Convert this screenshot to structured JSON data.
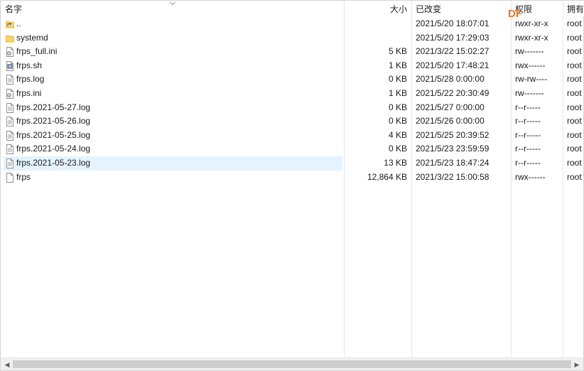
{
  "columns": {
    "name": "名字",
    "size": "大小",
    "modified": "已改变",
    "permissions": "权限",
    "owner": "拥有"
  },
  "watermark": "DF",
  "files": [
    {
      "name": "..",
      "size": "",
      "modified": "2021/5/20 18:07:01",
      "permissions": "rwxr-xr-x",
      "owner": "root",
      "icon": "parent-folder-icon"
    },
    {
      "name": "systemd",
      "size": "",
      "modified": "2021/5/20 17:29:03",
      "permissions": "rwxr-xr-x",
      "owner": "root",
      "icon": "folder-icon"
    },
    {
      "name": "frps_full.ini",
      "size": "5 KB",
      "modified": "2021/3/22 15:02:27",
      "permissions": "rw-------",
      "owner": "root",
      "icon": "settings-file-icon"
    },
    {
      "name": "frps.sh",
      "size": "1 KB",
      "modified": "2021/5/20 17:48:21",
      "permissions": "rwx------",
      "owner": "root",
      "icon": "script-file-icon"
    },
    {
      "name": "frps.log",
      "size": "0 KB",
      "modified": "2021/5/28 0:00:00",
      "permissions": "rw-rw----",
      "owner": "root",
      "icon": "text-file-icon"
    },
    {
      "name": "frps.ini",
      "size": "1 KB",
      "modified": "2021/5/22 20:30:49",
      "permissions": "rw-------",
      "owner": "root",
      "icon": "settings-file-icon"
    },
    {
      "name": "frps.2021-05-27.log",
      "size": "0 KB",
      "modified": "2021/5/27 0:00:00",
      "permissions": "r--r-----",
      "owner": "root",
      "icon": "text-file-icon"
    },
    {
      "name": "frps.2021-05-26.log",
      "size": "0 KB",
      "modified": "2021/5/26 0:00:00",
      "permissions": "r--r-----",
      "owner": "root",
      "icon": "text-file-icon"
    },
    {
      "name": "frps.2021-05-25.log",
      "size": "4 KB",
      "modified": "2021/5/25 20:39:52",
      "permissions": "r--r-----",
      "owner": "root",
      "icon": "text-file-icon"
    },
    {
      "name": "frps.2021-05-24.log",
      "size": "0 KB",
      "modified": "2021/5/23 23:59:59",
      "permissions": "r--r-----",
      "owner": "root",
      "icon": "text-file-icon"
    },
    {
      "name": "frps.2021-05-23.log",
      "size": "13 KB",
      "modified": "2021/5/23 18:47:24",
      "permissions": "r--r-----",
      "owner": "root",
      "icon": "text-file-icon",
      "selected": true
    },
    {
      "name": "frps",
      "size": "12,864 KB",
      "modified": "2021/3/22 15:00:58",
      "permissions": "rwx------",
      "owner": "root",
      "icon": "blank-file-icon"
    }
  ]
}
